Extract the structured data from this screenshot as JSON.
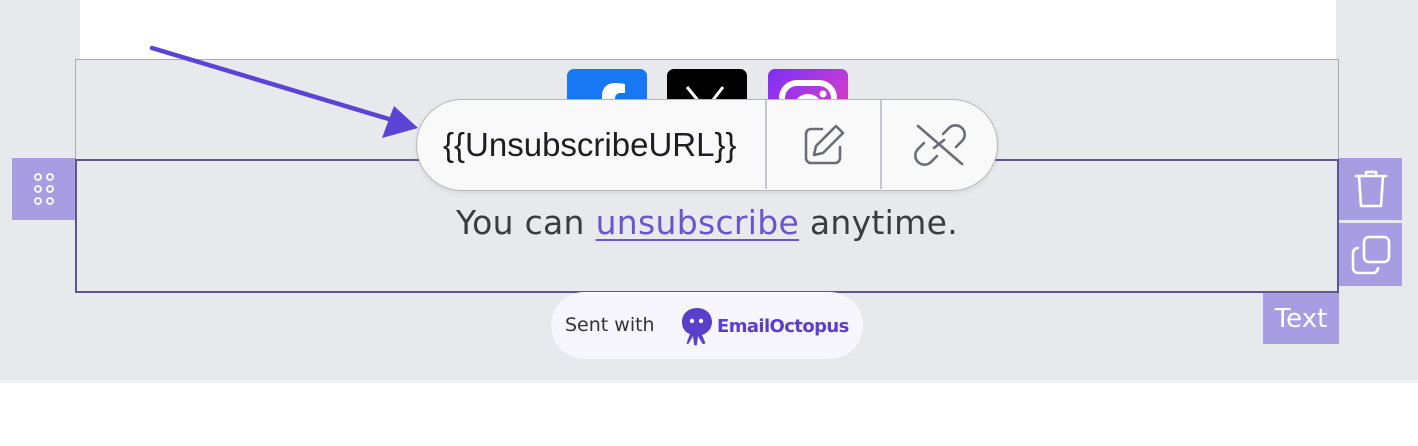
{
  "footer_text": {
    "prefix": "You can ",
    "link_label": "unsubscribe",
    "suffix": " anytime."
  },
  "link_popover": {
    "url": "{{UnsubscribeURL}}",
    "edit_icon": "pencil-square-icon",
    "unlink_icon": "broken-link-icon"
  },
  "social_icons": [
    "facebook-icon",
    "x-icon",
    "instagram-icon"
  ],
  "block_toolbar": {
    "drag_icon": "grip-dots-icon",
    "delete_icon": "trash-icon",
    "duplicate_icon": "copy-icon",
    "block_type": "Text"
  },
  "branding": {
    "prefix": "Sent with",
    "name": "EmailOctopus"
  },
  "colors": {
    "accent": "#a89de2",
    "link": "#6b54cf",
    "brand": "#5a3fc8",
    "canvas": "#e8e9ec"
  }
}
